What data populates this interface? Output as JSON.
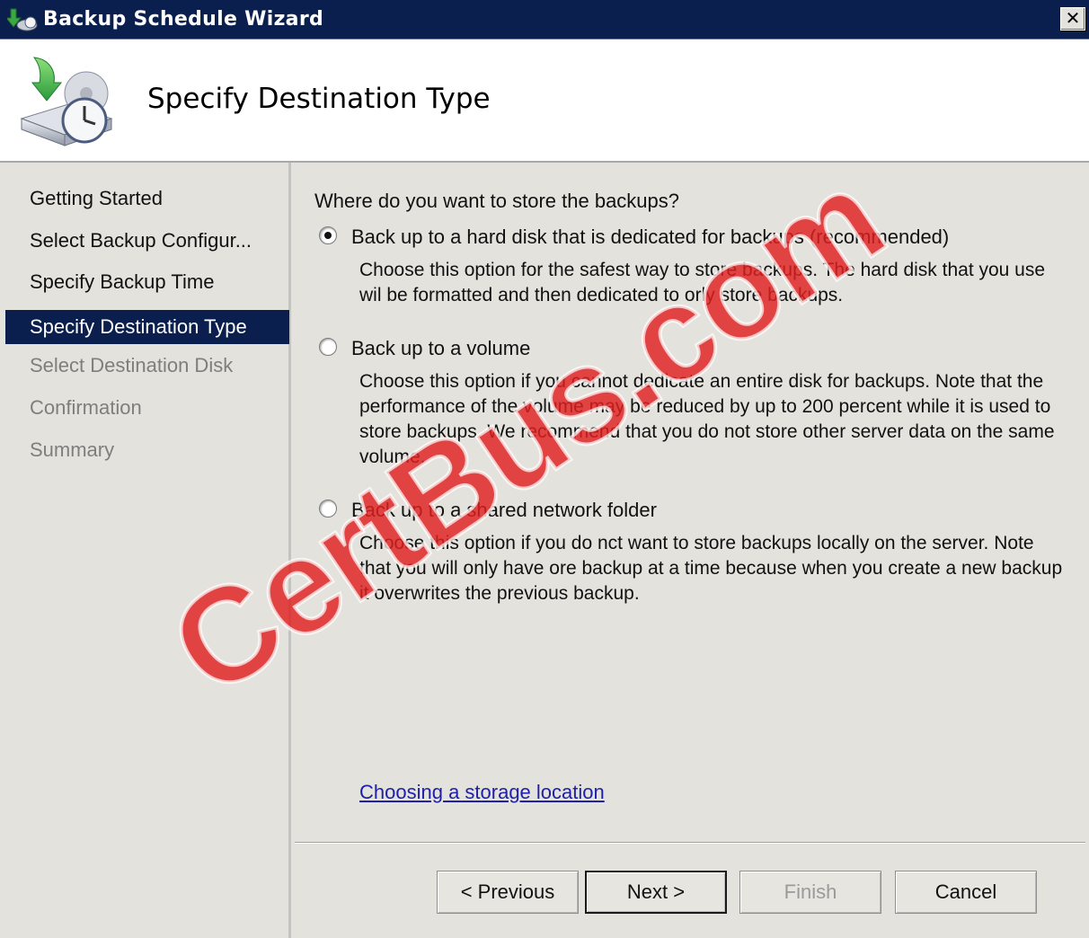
{
  "window": {
    "title": "Backup Schedule Wizard",
    "close_glyph": "✕"
  },
  "header": {
    "page_title": "Specify Destination Type",
    "icon": "backup-schedule-icon"
  },
  "sidebar": {
    "steps": [
      {
        "label": "Getting Started",
        "state": "completed"
      },
      {
        "label": "Select Backup Configur...",
        "state": "completed"
      },
      {
        "label": "Specify Backup Time",
        "state": "completed"
      },
      {
        "label": "Specify Destination Type",
        "state": "current"
      },
      {
        "label": "Select Destination Disk",
        "state": "disabled"
      },
      {
        "label": "Confirmation",
        "state": "disabled"
      },
      {
        "label": "Summary",
        "state": "disabled"
      }
    ]
  },
  "main": {
    "question": "Where do you want to store the backups?",
    "options": [
      {
        "label": "Back up to a hard disk that is dedicated for backups (recommended)",
        "description": "Choose this option for the safest way to store backups. The hard disk that you use wil be formatted and then dedicated to orly store backups.",
        "selected": true
      },
      {
        "label": "Back up to a volume",
        "description": "Choose this option if you cannot dedicate an entire disk for backups. Note that the performance of the volume may be reduced by up to 200 percent while it is used to store backups. We recommend that you do not store other server data on the same volume.",
        "selected": false
      },
      {
        "label": "Back up to a shared network folder",
        "description": "Choose this option if you do nct want to store backups locally on the server. Note that you will only have ore backup at a time because when you create a new backup it overwrites the previous backup.",
        "selected": false
      }
    ],
    "help_link": "Choosing a storage location"
  },
  "buttons": {
    "previous": "< Previous",
    "next": "Next >",
    "finish": "Finish",
    "cancel": "Cancel"
  },
  "watermark": {
    "text": "CertBus.com",
    "color": "#e02020"
  },
  "colors": {
    "titlebar": "#0b1f4e",
    "selected_step": "#0b1f4e",
    "panel": "#e3e2dc",
    "link": "#1f1fa8"
  }
}
